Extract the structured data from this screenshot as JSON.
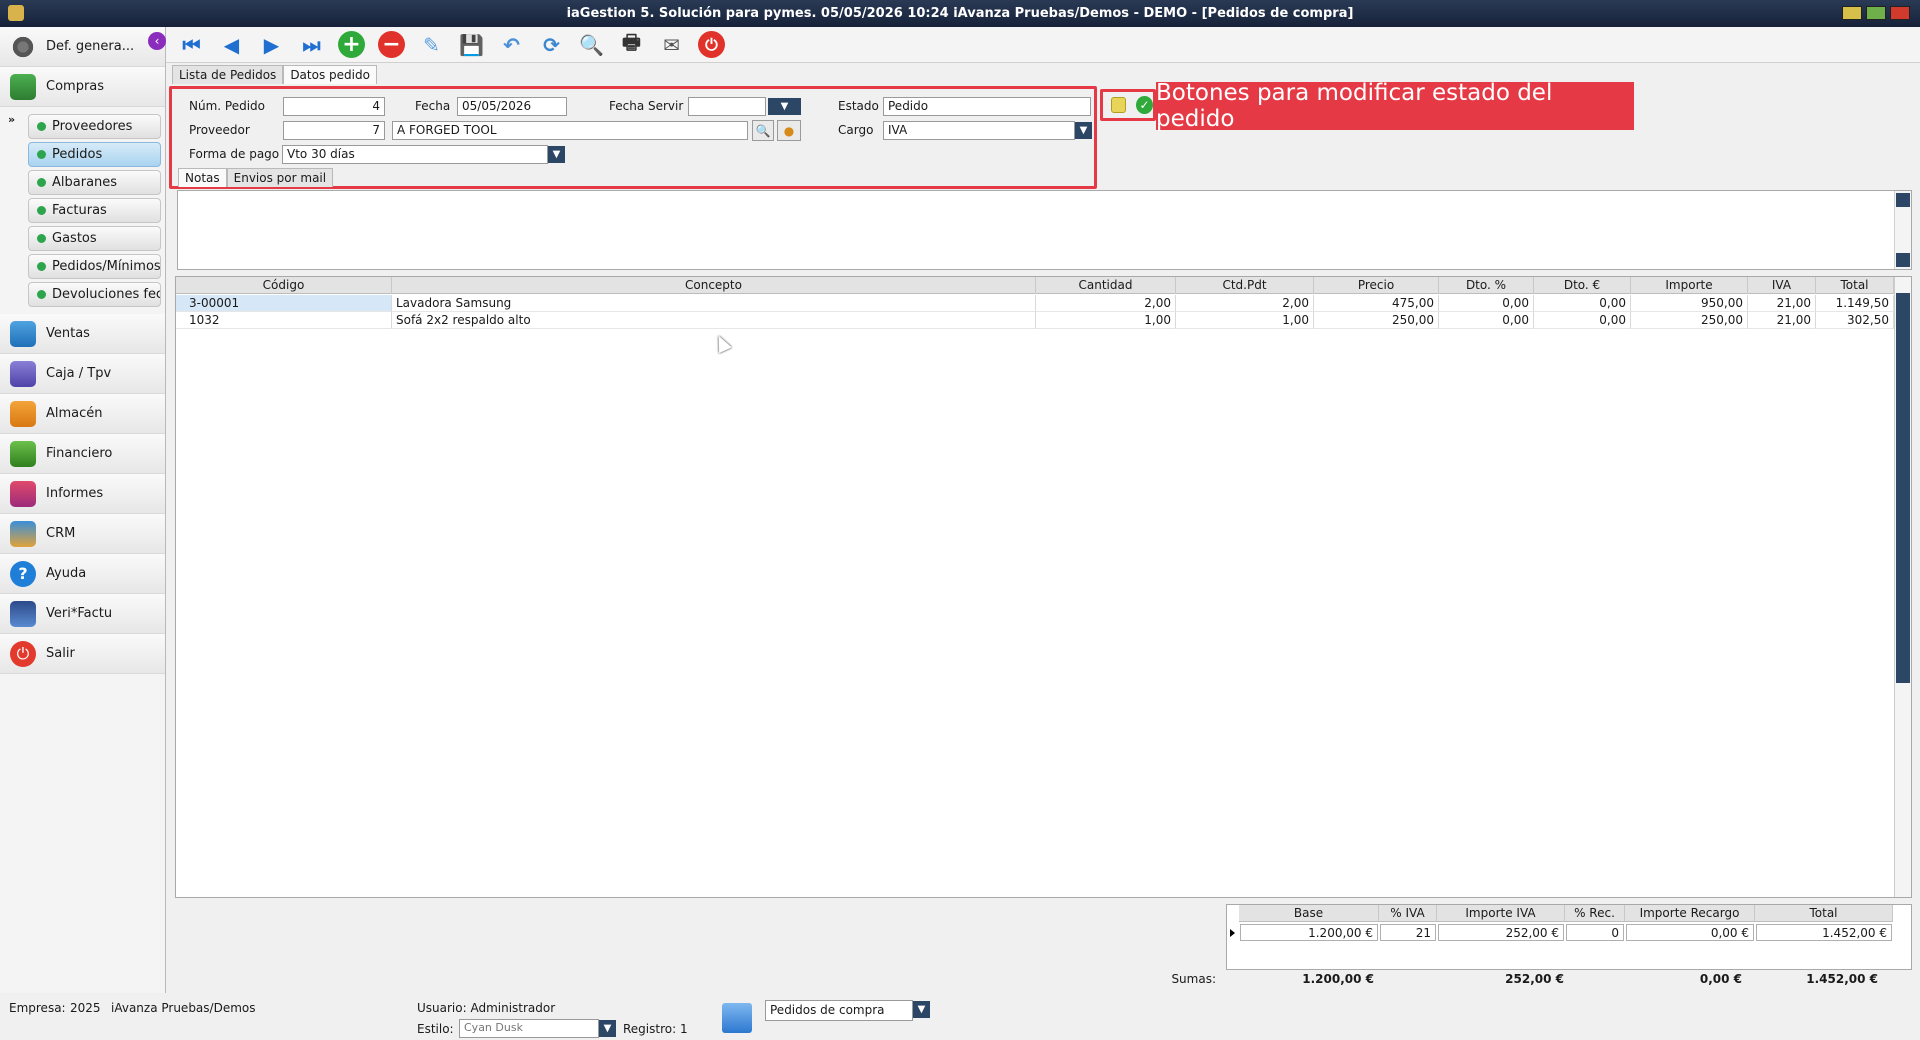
{
  "window": {
    "title": "iaGestion 5. Solución para pymes.  05/05/2026 10:24   iAvanza Pruebas/Demos - DEMO - [Pedidos de compra]"
  },
  "sidebar": {
    "config_label": "Def. genera...",
    "compras_label": "Compras",
    "submenu": [
      "Proveedores",
      "Pedidos",
      "Albaranes",
      "Facturas",
      "Gastos",
      "Pedidos/Mínimos",
      "Devoluciones fecha"
    ],
    "main_items": [
      "Ventas",
      "Caja / Tpv",
      "Almacén",
      "Financiero",
      "Informes",
      "CRM",
      "Ayuda",
      "Veri*Factu",
      "Salir"
    ]
  },
  "tabs": {
    "top": [
      "Lista de Pedidos",
      "Datos pedido"
    ],
    "notes": [
      "Notas",
      "Envios por mail"
    ]
  },
  "form": {
    "num_pedido_label": "Núm. Pedido",
    "num_pedido": "4",
    "fecha_label": "Fecha",
    "fecha": "05/05/2026",
    "fecha_servir_label": "Fecha Servir",
    "fecha_servir": "",
    "estado_label": "Estado",
    "estado": "Pedido",
    "proveedor_label": "Proveedor",
    "proveedor_code": "7",
    "proveedor_name": "A FORGED TOOL",
    "cargo_label": "Cargo",
    "cargo": "IVA",
    "forma_pago_label": "Forma de pago",
    "forma_pago": "Vto 30 días"
  },
  "callout": "Botones para modificar estado del pedido",
  "grid": {
    "columns": [
      "Código",
      "Concepto",
      "Cantidad",
      "Ctd.Pdt",
      "Precio",
      "Dto. %",
      "Dto. €",
      "Importe",
      "IVA",
      "Total"
    ],
    "rows": [
      [
        "3-00001",
        "Lavadora Samsung",
        "2,00",
        "2,00",
        "475,00",
        "0,00",
        "0,00",
        "950,00",
        "21,00",
        "1.149,50"
      ],
      [
        "1032",
        "Sofá 2x2 respaldo alto",
        "1,00",
        "1,00",
        "250,00",
        "0,00",
        "0,00",
        "250,00",
        "21,00",
        "302,50"
      ]
    ]
  },
  "totals": {
    "columns": [
      "Base",
      "% IVA",
      "Importe IVA",
      "% Rec.",
      "Importe Recargo",
      "Total"
    ],
    "row": [
      "1.200,00 €",
      "21",
      "252,00 €",
      "0",
      "0,00 €",
      "1.452,00 €"
    ],
    "sumas_label": "Sumas:",
    "sumas": [
      "1.200,00 €",
      "252,00 €",
      "0,00 €",
      "1.452,00 €"
    ]
  },
  "status": {
    "empresa_label": "Empresa:",
    "empresa_year": "2025",
    "empresa_name": "iAvanza Pruebas/Demos",
    "usuario": "Usuario: Administrador",
    "estilo_label": "Estilo:",
    "estilo": "Cyan Dusk",
    "registro": "Registro:  1",
    "modulo": "Pedidos de compra"
  },
  "icons": [
    "gear-icon",
    "cart-icon",
    "first-record-icon",
    "prev-record-icon",
    "next-record-icon",
    "last-record-icon",
    "add-icon",
    "delete-icon",
    "edit-icon",
    "save-icon",
    "undo-icon",
    "refresh-icon",
    "search-list-icon",
    "print-icon",
    "email-tools-icon",
    "power-icon"
  ]
}
